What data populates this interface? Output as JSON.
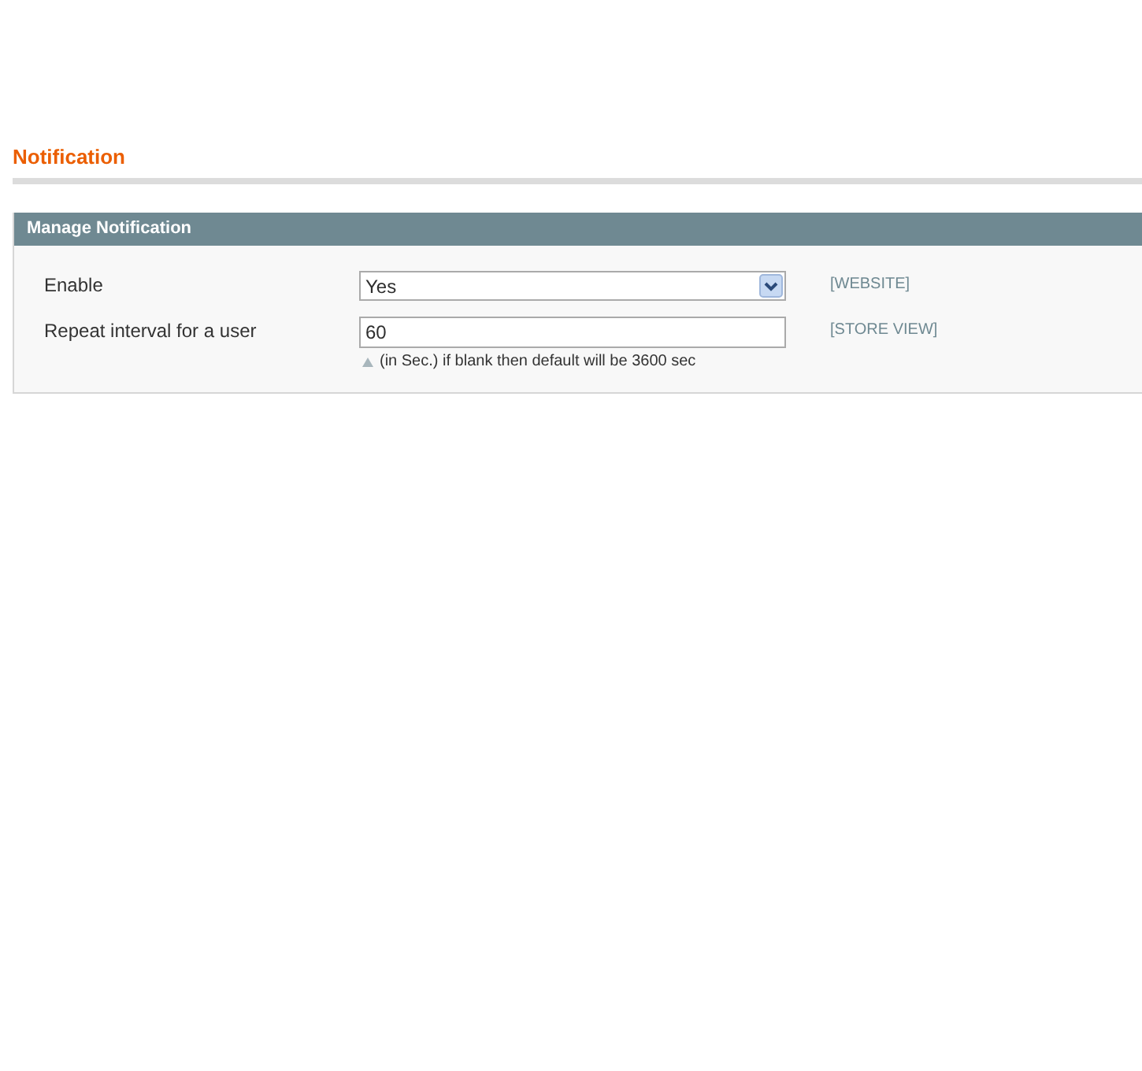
{
  "page_title": "Notification",
  "section": {
    "title": "Manage Notification",
    "fields": [
      {
        "kind": "select",
        "label": "Enable",
        "value": "Yes",
        "scope": "[WEBSITE]"
      },
      {
        "kind": "text",
        "label": "Repeat interval for a user",
        "value": "60",
        "scope": "[STORE VIEW]",
        "note": "(in Sec.) if blank then default will be 3600 sec"
      }
    ]
  }
}
